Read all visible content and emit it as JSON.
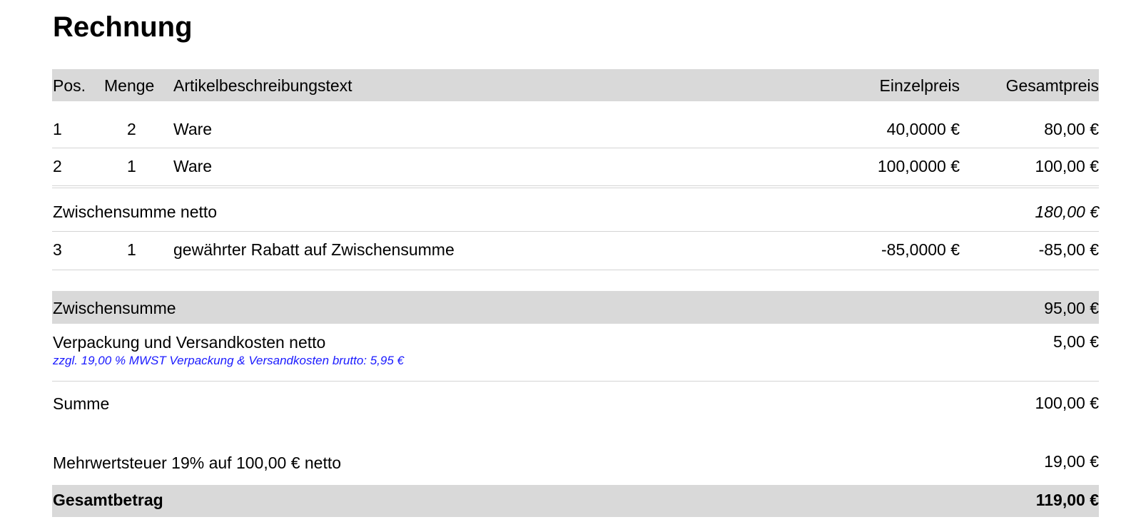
{
  "title": "Rechnung",
  "header": {
    "pos": "Pos.",
    "menge": "Menge",
    "beschreibung": "Artikelbeschreibungstext",
    "einzelpreis": "Einzelpreis",
    "gesamtpreis": "Gesamtpreis"
  },
  "items": [
    {
      "pos": "1",
      "menge": "2",
      "text": "Ware",
      "einzelpreis": "40,0000 €",
      "gesamtpreis": "80,00 €"
    },
    {
      "pos": "2",
      "menge": "1",
      "text": "Ware",
      "einzelpreis": "100,0000 €",
      "gesamtpreis": "100,00 €"
    }
  ],
  "subtotal_net": {
    "label": "Zwischensumme netto",
    "value": "180,00 €"
  },
  "discount": {
    "pos": "3",
    "menge": "1",
    "text": "gewährter Rabatt auf Zwischensumme",
    "einzelpreis": "-85,0000 €",
    "gesamtpreis": "-85,00 €"
  },
  "subtotal": {
    "label": "Zwischensumme",
    "value": "95,00 €"
  },
  "shipping": {
    "label": "Verpackung und Versandkosten netto",
    "note": "zzgl. 19,00 % MWST Verpackung & Versandkosten brutto: 5,95 €",
    "value": "5,00 €"
  },
  "sum": {
    "label": "Summe",
    "value": "100,00 €"
  },
  "vat": {
    "label": "Mehrwertsteuer 19% auf 100,00 € netto",
    "value": "19,00 €"
  },
  "total": {
    "label": "Gesamtbetrag",
    "value": "119,00 €"
  },
  "colors": {
    "band": "#d9d9d9",
    "rule": "#d4d4d4",
    "note": "#1a1aff"
  }
}
